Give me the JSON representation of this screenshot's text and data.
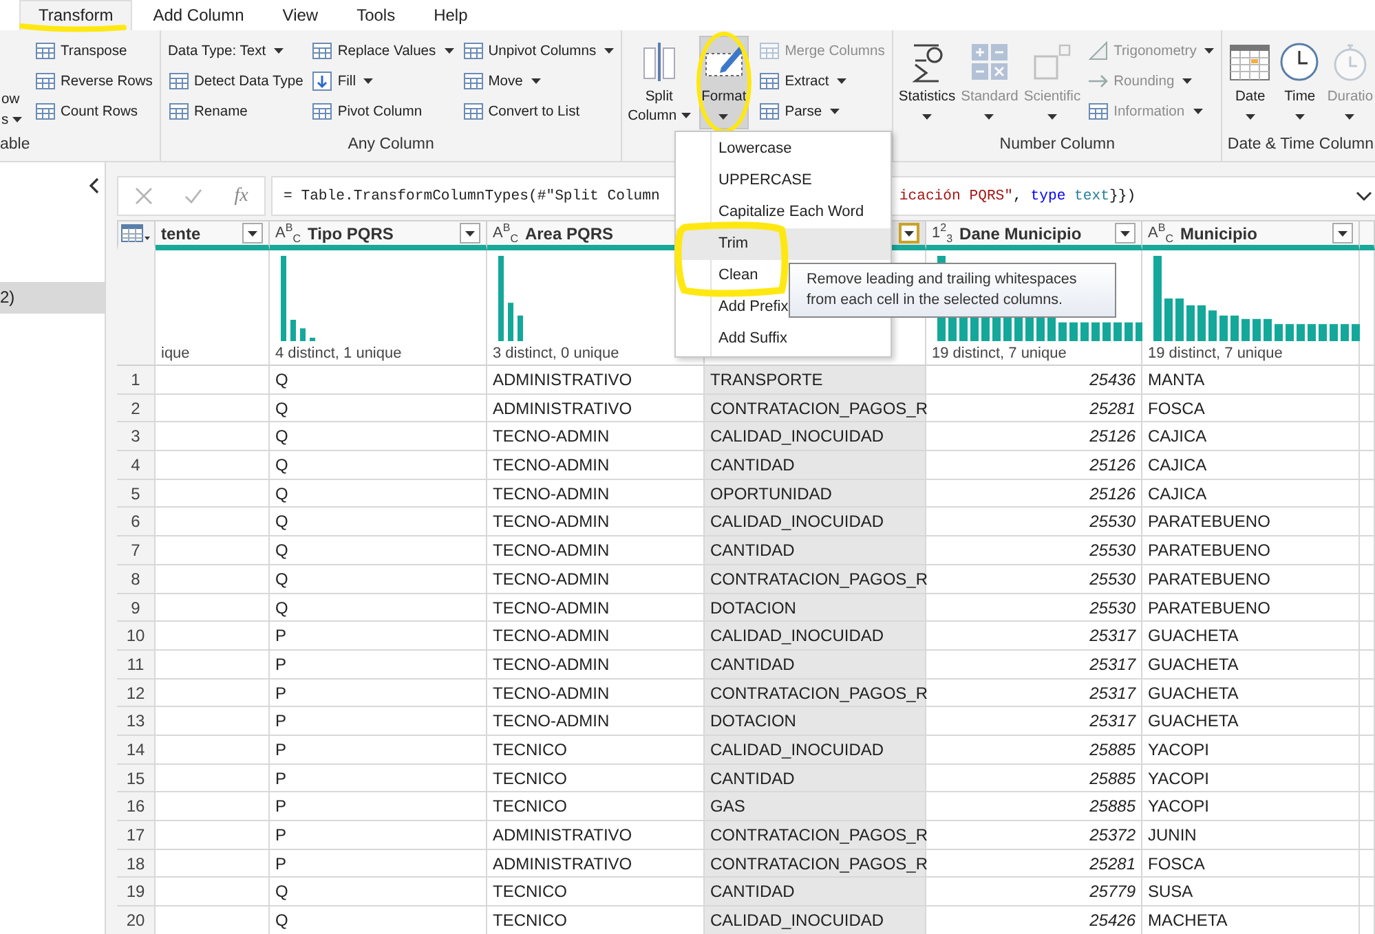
{
  "tabs": [
    {
      "label": "Transform",
      "selected": true
    },
    {
      "label": "Add Column",
      "selected": false
    },
    {
      "label": "View",
      "selected": false
    },
    {
      "label": "Tools",
      "selected": false
    },
    {
      "label": "Help",
      "selected": false
    }
  ],
  "ribbon": [
    {
      "label": "able",
      "columns": [
        {
          "kind": "large",
          "lines": [
            "ow",
            "s"
          ],
          "dropdown": true,
          "disabled": false,
          "pressed": false
        },
        {
          "kind": "stack",
          "items": [
            {
              "label": "Transpose",
              "dropdown": false,
              "disabled": false
            },
            {
              "label": "Reverse Rows",
              "dropdown": false,
              "disabled": false
            },
            {
              "label": "Count Rows",
              "dropdown": false,
              "disabled": false
            }
          ]
        }
      ]
    },
    {
      "label": "Any Column",
      "columns": [
        {
          "kind": "stack",
          "items": [
            {
              "label": "Data Type: Text",
              "dropdown": true,
              "disabled": false
            },
            {
              "label": "Detect Data Type",
              "dropdown": false,
              "disabled": false
            },
            {
              "label": "Rename",
              "dropdown": false,
              "disabled": false
            }
          ]
        },
        {
          "kind": "stack",
          "items": [
            {
              "label": "Replace Values",
              "dropdown": true,
              "disabled": false
            },
            {
              "label": "Fill",
              "dropdown": true,
              "disabled": false
            },
            {
              "label": "Pivot Column",
              "dropdown": false,
              "disabled": false
            }
          ]
        },
        {
          "kind": "stack",
          "items": [
            {
              "label": "Unpivot Columns",
              "dropdown": true,
              "disabled": false
            },
            {
              "label": "Move",
              "dropdown": true,
              "disabled": false
            },
            {
              "label": "Convert to List",
              "dropdown": false,
              "disabled": false
            }
          ]
        }
      ]
    },
    {
      "columns": [
        {
          "kind": "large",
          "lines": [
            "Split",
            "Column"
          ],
          "dropdown": true,
          "disabled": false,
          "pressed": false
        },
        {
          "kind": "large",
          "lines": [
            "Format"
          ],
          "dropdown": true,
          "disabled": false,
          "pressed": true
        },
        {
          "kind": "stack",
          "items": [
            {
              "label": "Merge Columns",
              "dropdown": false,
              "disabled": true
            },
            {
              "label": "Extract",
              "dropdown": true,
              "disabled": false
            },
            {
              "label": "Parse",
              "dropdown": true,
              "disabled": false
            }
          ]
        }
      ]
    },
    {
      "label": "Number Column",
      "columns": [
        {
          "kind": "large",
          "lines": [
            "Statistics"
          ],
          "dropdown": true,
          "disabled": false,
          "pressed": false
        },
        {
          "kind": "large",
          "lines": [
            "Standard"
          ],
          "dropdown": true,
          "disabled": true,
          "pressed": false
        },
        {
          "kind": "large",
          "lines": [
            "Scientific"
          ],
          "dropdown": true,
          "disabled": true,
          "pressed": false
        },
        {
          "kind": "stack",
          "items": [
            {
              "label": "Trigonometry",
              "dropdown": true,
              "disabled": true
            },
            {
              "label": "Rounding",
              "dropdown": true,
              "disabled": true
            },
            {
              "label": "Information",
              "dropdown": true,
              "disabled": true
            }
          ]
        }
      ]
    },
    {
      "label": "Date & Time Column",
      "columns": [
        {
          "kind": "large",
          "lines": [
            "Date"
          ],
          "dropdown": true,
          "disabled": false,
          "pressed": false
        },
        {
          "kind": "large",
          "lines": [
            "Time"
          ],
          "dropdown": true,
          "disabled": false,
          "pressed": false
        },
        {
          "kind": "large",
          "lines": [
            "Duratio"
          ],
          "dropdown": true,
          "disabled": true,
          "pressed": false
        }
      ]
    }
  ],
  "queries": [
    {
      "label": "2)",
      "selected": true
    }
  ],
  "formula": {
    "fx": "fx",
    "start": "= Table.TransformColumnTypes(#\"Split Column",
    "tail": [
      {
        "text": "icación PQRS\"",
        "kind": "string"
      },
      {
        "text": ", ",
        "kind": "plain"
      },
      {
        "text": "type",
        "kind": "keyword"
      },
      {
        "text": " text",
        "kind": "typename"
      },
      {
        "text": "}})",
        "kind": "plain"
      }
    ]
  },
  "columns": [
    {
      "name": "tente",
      "kind": "text",
      "selected": false,
      "filter": true,
      "profile": "ique"
    },
    {
      "name": "Tipo PQRS",
      "type": "A$^{B}$$_{C}$",
      "kind": "text",
      "selected": false,
      "filter": true,
      "profile": "4 distinct, 1 unique"
    },
    {
      "name": "Area PQRS",
      "type": "A$^{B}$$_{C}$",
      "kind": "text",
      "selected": false,
      "filter": false,
      "profile": "3 distinct, 0 unique"
    },
    {
      "kind": "text",
      "selected": true,
      "filter": true
    },
    {
      "name": "Dane Municipio",
      "type": "1$^{2}$$_{3}$",
      "kind": "number",
      "selected": false,
      "filter": true,
      "profile": "19 distinct, 7 unique"
    },
    {
      "name": "Municipio",
      "type": "A$^{B}$$_{C}$",
      "kind": "text",
      "selected": false,
      "filter": true,
      "profile": "19 distinct, 7 unique"
    },
    {
      "kind": "text",
      "selected": false,
      "filter": false
    }
  ],
  "rows": [
    {
      "num": "1",
      "cells": [
        "Q",
        "ADMINISTRATIVO",
        "TRANSPORTE",
        "25436",
        "MANTA"
      ]
    },
    {
      "num": "2",
      "cells": [
        "Q",
        "ADMINISTRATIVO",
        "CONTRATACION_PAGOS_R",
        "25281",
        "FOSCA"
      ]
    },
    {
      "num": "3",
      "cells": [
        "Q",
        "TECNO-ADMIN",
        "CALIDAD_INOCUIDAD",
        "25126",
        "CAJICA"
      ]
    },
    {
      "num": "4",
      "cells": [
        "Q",
        "TECNO-ADMIN",
        "CANTIDAD",
        "25126",
        "CAJICA"
      ]
    },
    {
      "num": "5",
      "cells": [
        "Q",
        "TECNO-ADMIN",
        "OPORTUNIDAD",
        "25126",
        "CAJICA"
      ]
    },
    {
      "num": "6",
      "cells": [
        "Q",
        "TECNO-ADMIN",
        "CALIDAD_INOCUIDAD",
        "25530",
        "PARATEBUENO"
      ]
    },
    {
      "num": "7",
      "cells": [
        "Q",
        "TECNO-ADMIN",
        "CANTIDAD",
        "25530",
        "PARATEBUENO"
      ]
    },
    {
      "num": "8",
      "cells": [
        "Q",
        "TECNO-ADMIN",
        "CONTRATACION_PAGOS_R",
        "25530",
        "PARATEBUENO"
      ]
    },
    {
      "num": "9",
      "cells": [
        "Q",
        "TECNO-ADMIN",
        "DOTACION",
        "25530",
        "PARATEBUENO"
      ]
    },
    {
      "num": "10",
      "cells": [
        "P",
        "TECNO-ADMIN",
        "CALIDAD_INOCUIDAD",
        "25317",
        "GUACHETA"
      ]
    },
    {
      "num": "11",
      "cells": [
        "P",
        "TECNO-ADMIN",
        "CANTIDAD",
        "25317",
        "GUACHETA"
      ]
    },
    {
      "num": "12",
      "cells": [
        "P",
        "TECNO-ADMIN",
        "CONTRATACION_PAGOS_R",
        "25317",
        "GUACHETA"
      ]
    },
    {
      "num": "13",
      "cells": [
        "P",
        "TECNO-ADMIN",
        "DOTACION",
        "25317",
        "GUACHETA"
      ]
    },
    {
      "num": "14",
      "cells": [
        "P",
        "TECNICO",
        "CALIDAD_INOCUIDAD",
        "25885",
        "YACOPI"
      ]
    },
    {
      "num": "15",
      "cells": [
        "P",
        "TECNICO",
        "CANTIDAD",
        "25885",
        "YACOPI"
      ]
    },
    {
      "num": "16",
      "cells": [
        "P",
        "TECNICO",
        "GAS",
        "25885",
        "YACOPI"
      ]
    },
    {
      "num": "17",
      "cells": [
        "P",
        "ADMINISTRATIVO",
        "CONTRATACION_PAGOS_R",
        "25372",
        "JUNIN"
      ]
    },
    {
      "num": "18",
      "cells": [
        "P",
        "ADMINISTRATIVO",
        "CONTRATACION_PAGOS_R",
        "25281",
        "FOSCA"
      ]
    },
    {
      "num": "19",
      "cells": [
        "Q",
        "TECNICO",
        "CANTIDAD",
        "25779",
        "SUSA"
      ]
    },
    {
      "num": "20",
      "cells": [
        "Q",
        "TECNICO",
        "CALIDAD_INOCUIDAD",
        "25426",
        "MACHETA"
      ]
    }
  ],
  "menu": [
    {
      "label": "Lowercase",
      "selected": false
    },
    {
      "label": "UPPERCASE",
      "selected": false
    },
    {
      "label": "Capitalize Each Word",
      "selected": false
    },
    {
      "label": "Trim",
      "selected": true
    },
    {
      "label": "Clean",
      "selected": false
    },
    {
      "label": "Add Prefix",
      "selected": false
    },
    {
      "label": "Add Suffix",
      "selected": false
    }
  ],
  "tooltip": "Remove leading and trailing whitespaces from each cell in the selected columns."
}
